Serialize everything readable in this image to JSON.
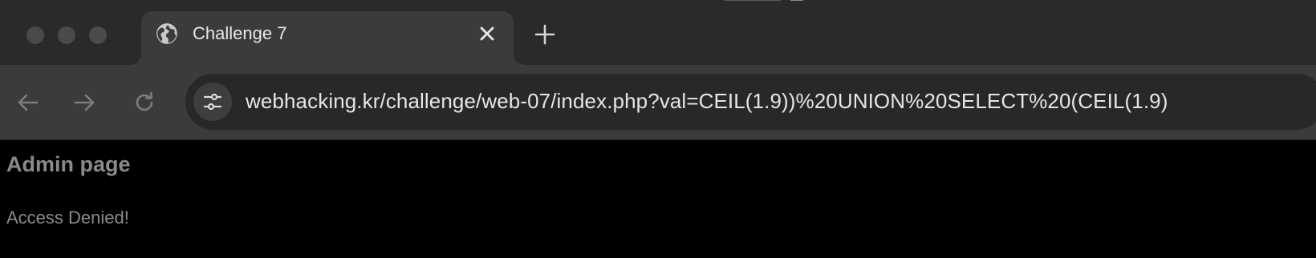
{
  "browser": {
    "window_controls": [
      "close",
      "minimize",
      "zoom"
    ],
    "tab": {
      "title": "Challenge 7",
      "favicon": "globe-icon",
      "close_icon": "close-icon"
    },
    "new_tab_icon": "plus-icon",
    "nav": {
      "back_icon": "arrow-left-icon",
      "forward_icon": "arrow-right-icon",
      "reload_icon": "reload-icon"
    },
    "address_bar": {
      "site_info_icon": "tune-icon",
      "domain": "webhacking.kr",
      "path": "/challenge/web-07/index.php?val=CEIL(1.9))%20UNION%20SELECT%20(CEIL(1.9)"
    }
  },
  "page": {
    "heading": "Admin page",
    "message": "Access Denied!"
  },
  "colors": {
    "tabstrip": "#2a2a2c",
    "toolbar": "#3b3b3d",
    "omnibox": "#282829",
    "page_background": "#000000",
    "page_text": "#8a8a8a"
  }
}
